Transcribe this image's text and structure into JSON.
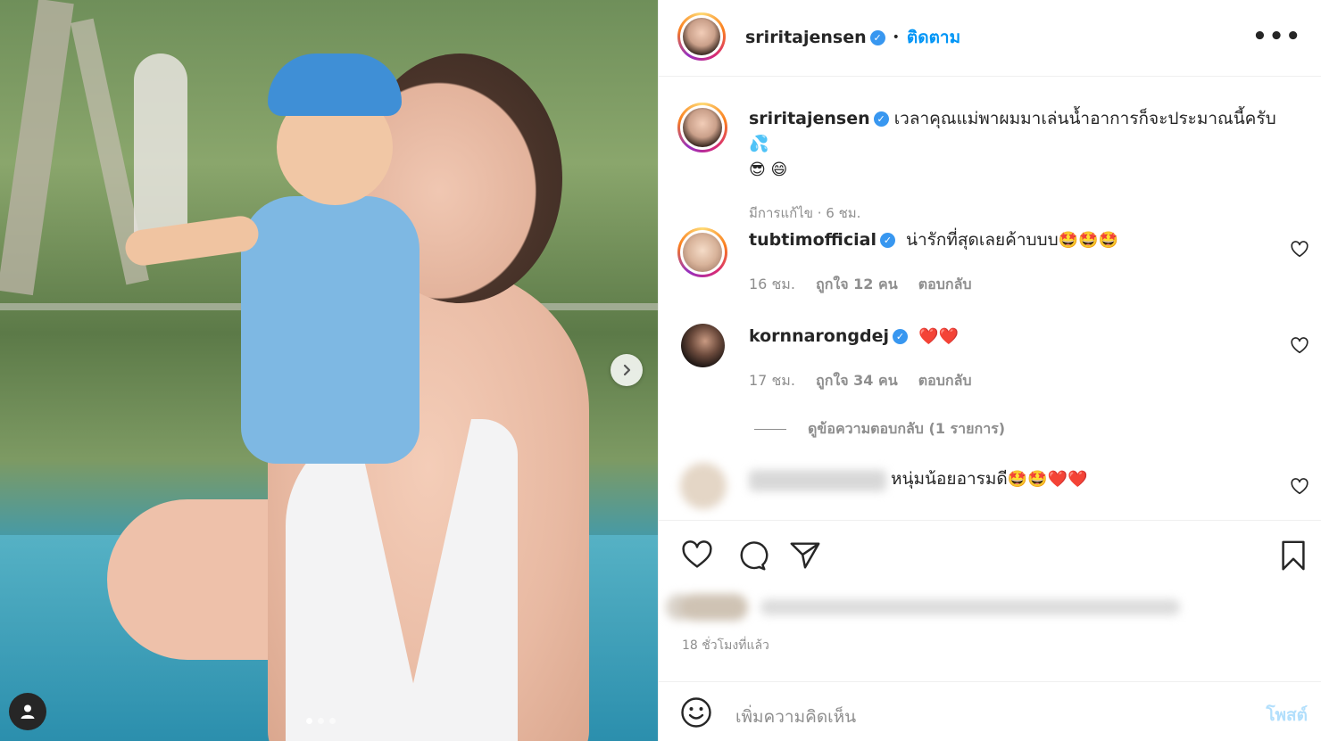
{
  "post": {
    "username": "sriritajensen",
    "follow_label": "ติดตาม",
    "separator": "•",
    "more_label": "•••",
    "caption_text": "เวลาคุณแม่พาผมมาเล่นน้ำอาการก็จะประมาณนี้ครับ",
    "caption_emoji_1": "💦",
    "caption_emoji_2": "😎 😄",
    "edited": "มีการแก้ไข · 6 ชม.",
    "time_ago": "18 ชั่วโมงที่แล้ว",
    "carousel": {
      "total": 3,
      "current": 1
    }
  },
  "comments": [
    {
      "username": "tubtimofficial",
      "text": "น่ารักที่สุดเลยค้าบบบ",
      "emoji": "🤩🤩🤩",
      "time": "16 ชม.",
      "likes": "ถูกใจ 12 คน",
      "reply": "ตอบกลับ"
    },
    {
      "username": "kornnarongdej",
      "text": "",
      "emoji": "❤️❤️",
      "time": "17 ชม.",
      "likes": "ถูกใจ 34 คน",
      "reply": "ตอบกลับ",
      "view_replies": "ดูข้อความตอบกลับ (1 รายการ)"
    },
    {
      "username": "",
      "text": "หนุ่มน้อยอารมดี",
      "emoji": "🤩🤩❤️❤️"
    }
  ],
  "comment_box": {
    "placeholder": "เพิ่มความคิดเห็น",
    "post_label": "โพสต์"
  },
  "colors": {
    "verified": "#3897f0",
    "link": "#0095f6",
    "muted": "#8e8e8e",
    "post_disabled": "#b2dffc"
  }
}
